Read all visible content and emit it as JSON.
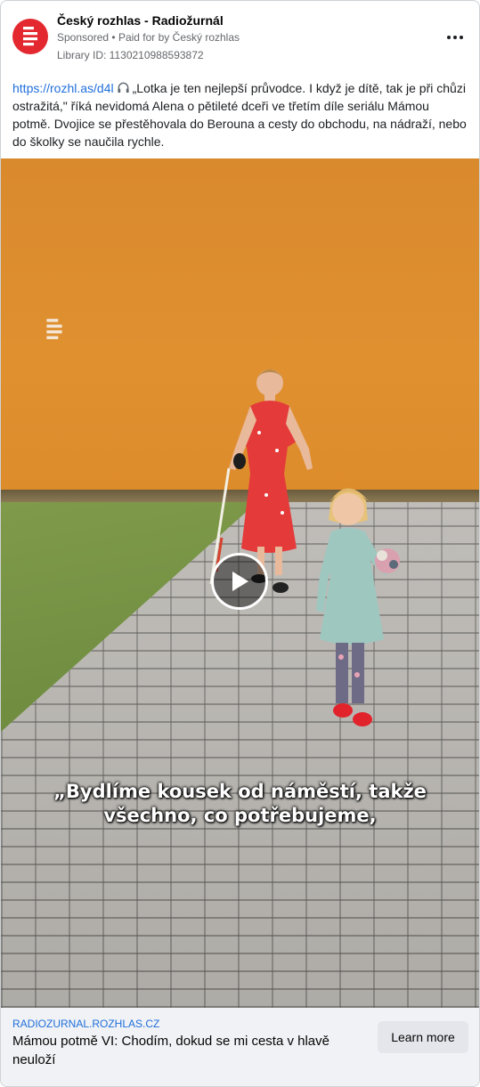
{
  "post": {
    "page_name": "Český rozhlas - Radiožurnál",
    "sponsored_label": "Sponsored",
    "paid_for_prefix": "Paid for by",
    "advertiser": "Český rozhlas",
    "library_id": "Library ID: 1130210988593872",
    "avatar_icon": "cesky-rozhlas-logo",
    "brand_color": "#e3282f",
    "link_color": "#216fdb"
  },
  "body": {
    "link_text": "https://rozhl.as/d4l",
    "icon": "headphones-icon",
    "text": "„Lotka je ten nejlepší průvodce. I když je dítě, tak je při chůzi ostražitá,\" říká nevidomá Alena o pětileté dceři ve třetím díle seriálu Mámou potmě. Dvojice se přestěhovala do Berouna a cesty do obchodu, na nádraží, nebo do školky se naučila rychle."
  },
  "video": {
    "caption_line1": "„Bydlíme kousek od náměstí, takže",
    "caption_line2": "všechno, co potřebujeme,",
    "play_icon": "play-icon",
    "watermark_icon": "cesky-rozhlas-logo"
  },
  "footer": {
    "domain": "RADIOZURNAL.ROZHLAS.CZ",
    "title": "Mámou potmě VI: Chodím, dokud se mi cesta v hlavě neuloží",
    "cta_label": "Learn more"
  }
}
